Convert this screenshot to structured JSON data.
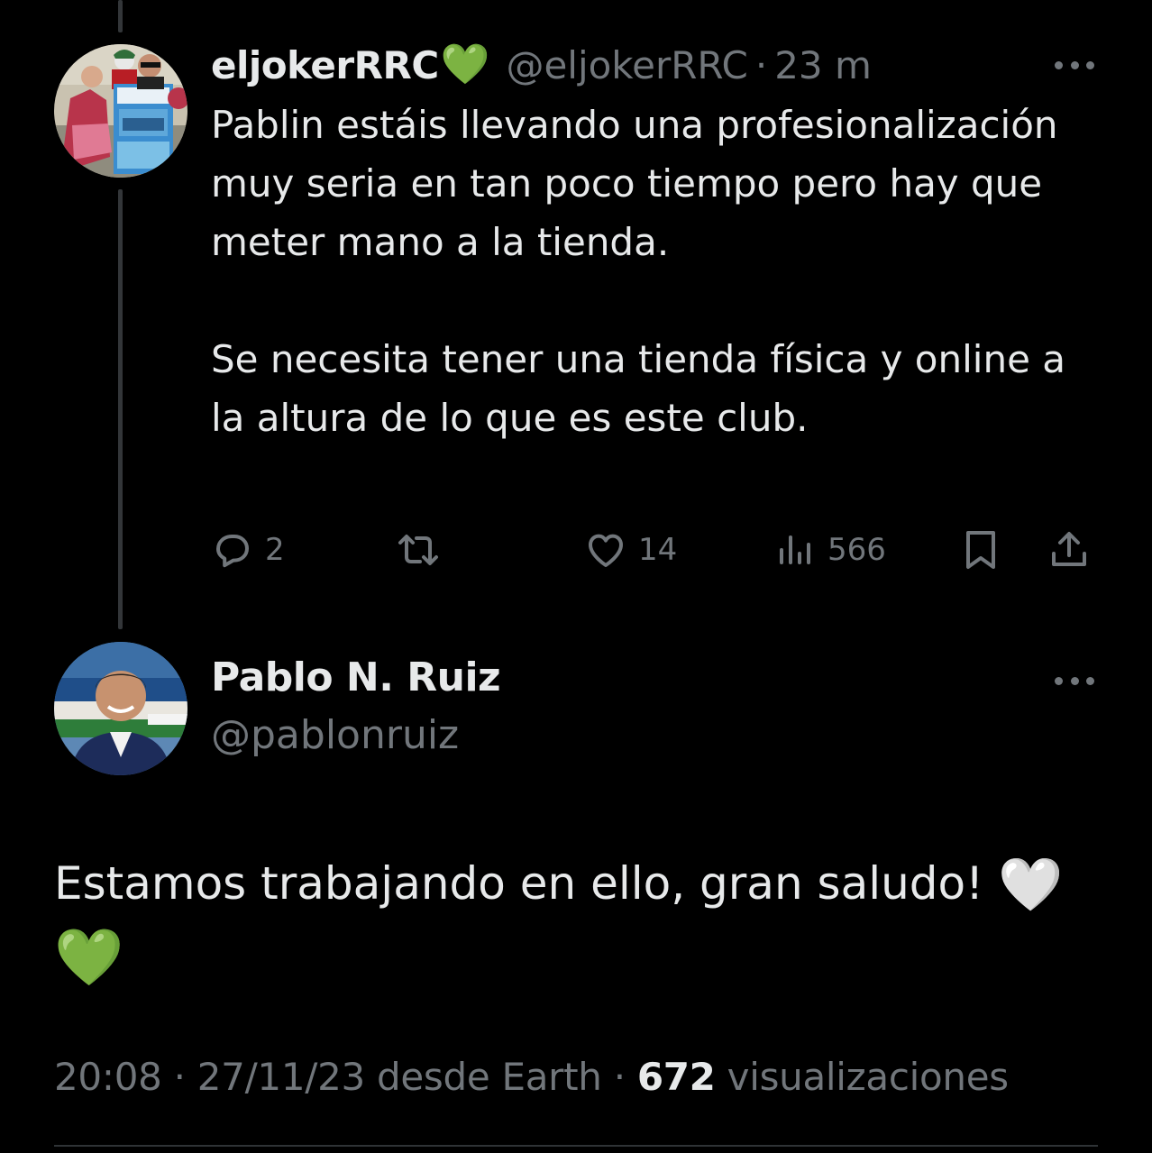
{
  "tweet1": {
    "display_name": "eljokerRRC",
    "name_emoji": "💚",
    "handle": "@eljokerRRC",
    "separator": "·",
    "time": "23 m",
    "paragraphs": [
      "Pablin estáis llevando una profesionalización muy seria en tan poco tiempo pero hay que meter mano a la tienda.",
      "Se necesita tener una tienda física y online a la altura de lo que es este club."
    ],
    "actions": {
      "reply_count": "2",
      "retweet_count": "",
      "like_count": "14",
      "views_count": "566"
    },
    "icons": [
      "reply-icon",
      "retweet-icon",
      "like-icon",
      "views-icon",
      "bookmark-icon",
      "share-icon",
      "more-icon"
    ]
  },
  "tweet2": {
    "display_name": "Pablo N. Ruiz",
    "handle": "@pablonruiz",
    "text": "Estamos trabajando en ello, gran saludo!",
    "emoji_white_heart": "🤍",
    "emoji_green_heart": "💚",
    "meta": {
      "time": "20:08",
      "sep1": "·",
      "date": "27/11/23",
      "source_prefix": "desde",
      "source": "Earth",
      "sep2": "·",
      "views": "672",
      "views_label": "visualizaciones"
    }
  },
  "colors": {
    "background": "#000000",
    "text_primary": "#e7e9ea",
    "text_secondary": "#71767b",
    "thread_line": "#333639",
    "green_heart": "#4ed34a"
  }
}
